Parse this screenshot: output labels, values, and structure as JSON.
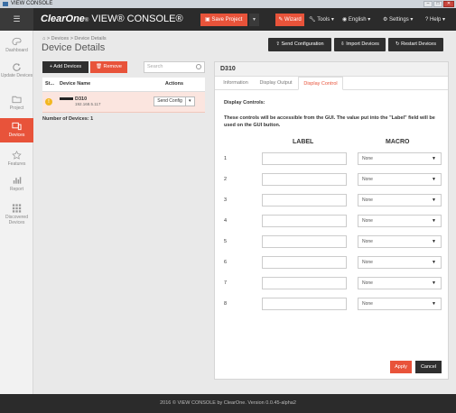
{
  "window": {
    "title": "VIEW CONSOLE",
    "controls": [
      "minimize-icon",
      "maximize-icon",
      "close-icon"
    ]
  },
  "topbar": {
    "brand_main": "ClearOne",
    "brand_mid": "®",
    "brand_product": "VIEW® CONSOLE®",
    "save_project": "Save Project",
    "wizard": "Wizard",
    "tools": "Tools ▾",
    "language": "English ▾",
    "settings": "Settings ▾",
    "help": "Help ▾",
    "accent_color": "#e8533a"
  },
  "sidebar": {
    "items": [
      {
        "label": "Dashboard",
        "icon": "palette-icon"
      },
      {
        "label": "Update Devices",
        "icon": "refresh-icon"
      },
      {
        "label": "Project",
        "icon": "folder-icon"
      },
      {
        "label": "Devices",
        "icon": "devices-icon",
        "active": true
      },
      {
        "label": "Features",
        "icon": "star-icon"
      },
      {
        "label": "Report",
        "icon": "bar-chart-icon"
      },
      {
        "label": "Discovered Devices",
        "icon": "grid-icon"
      }
    ]
  },
  "header": {
    "breadcrumb": "> Devices > Device Details",
    "title": "Device Details",
    "send_configuration": "Send Configuration",
    "import_devices": "Import Devices",
    "restart_devices": "Restart Devices"
  },
  "devices": {
    "add_label": "+ Add Devices",
    "remove_label": "Remove",
    "search_placeholder": "Search",
    "columns": [
      "St...",
      "Device Name",
      "Actions"
    ],
    "rows": [
      {
        "status": "!",
        "name": "D310",
        "ip": "192.168.5.117",
        "action": "Send Config"
      }
    ],
    "count_label": "Number of Devices: 1"
  },
  "detail": {
    "device_title": "D310",
    "tabs": [
      "Information",
      "Display Output",
      "Display Control"
    ],
    "active_tab": "Display Control",
    "section_title": "Display Controls:",
    "description": "These controls will be accessible from the GUI. The value put into the \"Label\" field will be used on the GUI button.",
    "label_header": "LABEL",
    "macro_header": "MACRO",
    "rows": [
      {
        "num": "1",
        "label": "",
        "macro": "None"
      },
      {
        "num": "2",
        "label": "",
        "macro": "None"
      },
      {
        "num": "3",
        "label": "",
        "macro": "None"
      },
      {
        "num": "4",
        "label": "",
        "macro": "None"
      },
      {
        "num": "5",
        "label": "",
        "macro": "None"
      },
      {
        "num": "6",
        "label": "",
        "macro": "None"
      },
      {
        "num": "7",
        "label": "",
        "macro": "None"
      },
      {
        "num": "8",
        "label": "",
        "macro": "None"
      }
    ],
    "apply": "Apply",
    "cancel": "Cancel"
  },
  "footer": {
    "text": "2016 © VIEW CONSOLE by ClearOne. Version 0.0.45-alpha2"
  }
}
